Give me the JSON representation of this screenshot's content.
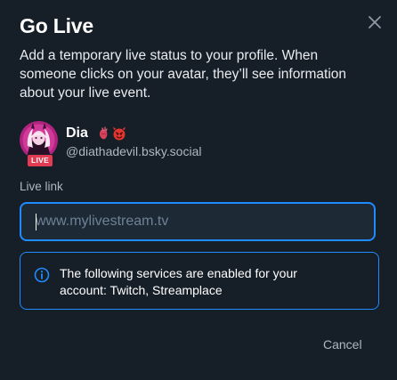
{
  "dialog": {
    "title": "Go Live",
    "description": "Add a temporary live status to your profile. When someone clicks on your avatar, they’ll see information about your live event.",
    "close_icon": "close-icon",
    "cancel_label": "Cancel"
  },
  "profile": {
    "display_name": "Dia",
    "handle": "@diathadevil.bsky.social",
    "live_badge": "LIVE",
    "emoji_icons": [
      "anatomical-heart-icon",
      "devil-face-icon"
    ]
  },
  "live_link": {
    "label": "Live link",
    "placeholder": "www.mylivestream.tv",
    "value": ""
  },
  "notice": {
    "icon": "info-icon",
    "text": "The following services are enabled for your account: Twitch, Streamplace"
  },
  "colors": {
    "background": "#161e27",
    "accent": "#208bfe",
    "live_badge": "#e23b53",
    "muted_text": "#aeb8c3",
    "input_background": "#1e2936"
  }
}
